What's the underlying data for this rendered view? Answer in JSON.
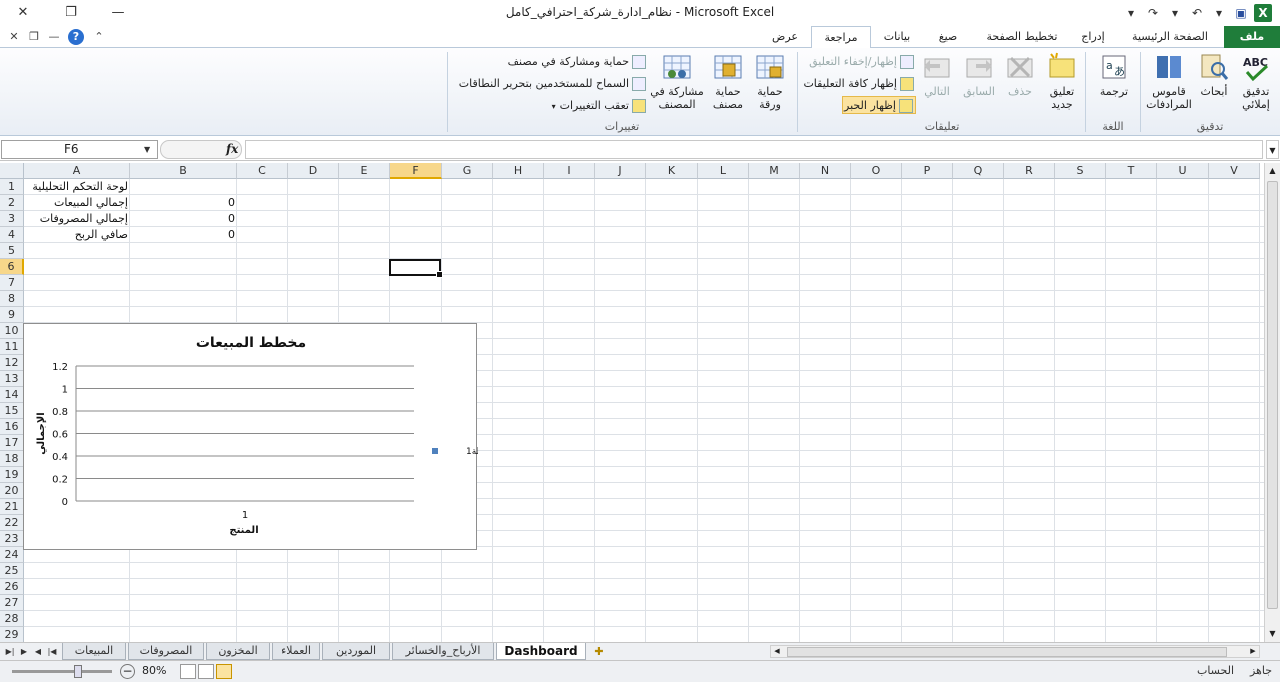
{
  "title_bar": {
    "title": "نظام_ادارة_شركة_احترافي_كامل  -  Microsoft Excel"
  },
  "tabs": [
    {
      "id": "file",
      "label": "ملف"
    },
    {
      "id": "home",
      "label": "الصفحة الرئيسية"
    },
    {
      "id": "insert",
      "label": "إدراج"
    },
    {
      "id": "layout",
      "label": "تخطيط الصفحة"
    },
    {
      "id": "formulas",
      "label": "صيغ"
    },
    {
      "id": "data",
      "label": "بيانات"
    },
    {
      "id": "review",
      "label": "مراجعة"
    },
    {
      "id": "view",
      "label": "عرض"
    }
  ],
  "ribbon": {
    "proofing": {
      "label": "تدقيق",
      "spelling": "تدقيق\nإملائي",
      "research": "أبحاث",
      "thesaurus": "قاموس\nالمرادفات"
    },
    "language": {
      "label": "اللغة",
      "translate": "ترجمة"
    },
    "comments": {
      "label": "تعليقات",
      "new_comment": "تعليق\nجديد",
      "delete": "حذف",
      "previous": "السابق",
      "next": "التالي",
      "show_hide": "إظهار/إخفاء التعليق",
      "show_all": "إظهار كافة التعليقات",
      "show_ink": "إظهار الحبر"
    },
    "changes": {
      "label": "تغييرات",
      "protect_sheet": "حماية\nورقة",
      "protect_workbook": "حماية\nمصنف",
      "share_workbook": "مشاركة في\nالمصنف",
      "protect_share": "حماية ومشاركة في مصنف",
      "allow_edit": "السماح للمستخدمين بتحرير النطاقات",
      "track_changes": "تعقب التغييرات"
    }
  },
  "formula_bar": {
    "name_box": "F6",
    "fx": "fx",
    "value": ""
  },
  "columns": [
    "A",
    "B",
    "C",
    "D",
    "E",
    "F",
    "G",
    "H",
    "I",
    "J",
    "K",
    "L",
    "M",
    "N",
    "O",
    "P",
    "Q",
    "R",
    "S",
    "T",
    "U",
    "V"
  ],
  "rows": [
    "1",
    "2",
    "3",
    "4",
    "5",
    "6",
    "7",
    "8",
    "9",
    "10",
    "11",
    "12",
    "13",
    "14",
    "15",
    "16",
    "17",
    "18",
    "19",
    "20",
    "21",
    "22",
    "23",
    "24",
    "25",
    "26",
    "27",
    "28",
    "29"
  ],
  "cells": {
    "A1": "لوحة التحكم التحليلية",
    "A2": "إجمالي المبيعات",
    "B2": "0",
    "A3": "إجمالي المصروفات",
    "B3": "0",
    "A4": "صافي الربح",
    "B4": "0"
  },
  "active_cell": "F6",
  "chart_data": {
    "type": "bar",
    "title": "مخطط المبيعات",
    "xlabel": "المنتج",
    "ylabel": "الإجمالي",
    "categories": [
      "1"
    ],
    "series": [
      {
        "name": "سلسلة1",
        "values": [
          0
        ]
      }
    ],
    "ylim": [
      0,
      1.2
    ],
    "yticks": [
      "0",
      "0.2",
      "0.4",
      "0.6",
      "0.8",
      "1",
      "1.2"
    ],
    "grid": true,
    "legend": "right",
    "series_color": "#4f81bd"
  },
  "sheet_tabs": [
    "Dashboard",
    "الأرباح_والخسائر",
    "الموردين",
    "العملاء",
    "المخزون",
    "المصروفات",
    "المبيعات"
  ],
  "active_sheet": "Dashboard",
  "status_bar": {
    "ready": "جاهز",
    "calculate": "الحساب",
    "zoom": "80%"
  },
  "colors": {
    "file_tab": "#1f7d3a",
    "selection_header": "#f7d78a"
  }
}
